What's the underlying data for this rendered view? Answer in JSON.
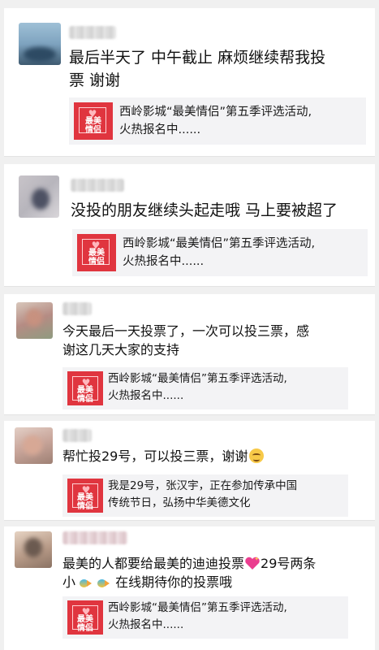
{
  "feed": {
    "posts": [
      {
        "text_line1": "最后半天了 中午截止 麻烦继续帮我投",
        "text_line2": "票 谢谢",
        "card": {
          "logo_text": "最美\n情侣",
          "title_line1": "西岭影城“最美情侣”第五季评选活动,",
          "title_line2": "火热报名中......"
        }
      },
      {
        "text_line1": "没投的朋友继续头起走哦 马上要被超了",
        "text_line2": "",
        "card": {
          "logo_text": "最美\n情侣",
          "title_line1": "西岭影城“最美情侣”第五季评选活动,",
          "title_line2": "火热报名中......"
        }
      },
      {
        "text_line1": "今天最后一天投票了，一次可以投三票，感",
        "text_line2": "谢这几天大家的支持",
        "card": {
          "logo_text": "最美\n情侣",
          "title_line1": "西岭影城“最美情侣”第五季评选活动,",
          "title_line2": "火热报名中......"
        }
      },
      {
        "text_line1": "帮忙投29号，可以投三票，谢谢",
        "text_line2": "",
        "card": {
          "logo_text": "最美\n情侣",
          "title_line1": "我是29号，张汉宇，正在参加传承中国",
          "title_line2": "传统节日，弘扬中华美德文化"
        }
      },
      {
        "text_line1_a": "最美的人都要给最美的迪迪投票",
        "text_line1_b": "29号两条",
        "text_line2_a": "小",
        "text_line2_b": "在线期待你的投票哦",
        "card": {
          "logo_text": "最美\n情侣",
          "title_line1": "西岭影城“最美情侣”第五季评选活动,",
          "title_line2": "火热报名中......"
        }
      }
    ]
  },
  "icons": {
    "heart_emoji": "sparkling-heart-icon",
    "smile_emoji": "smirk-face-icon",
    "fish_emoji": "tropical-fish-icon"
  },
  "colors": {
    "card_thumb": "#e0353f",
    "card_bg": "#f3f3f5",
    "feed_bg": "#f0f0f0"
  }
}
